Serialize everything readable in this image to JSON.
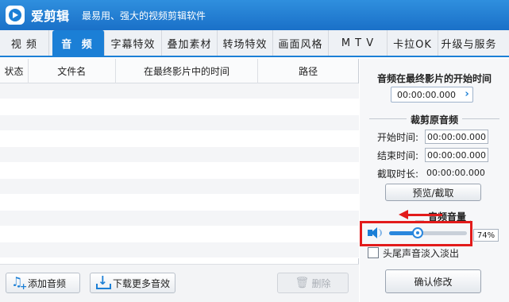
{
  "app": {
    "name": "爱剪辑",
    "slogan": "最易用、强大的视频剪辑软件"
  },
  "tabs": [
    {
      "label": "视 频",
      "active": false
    },
    {
      "label": "音 频",
      "active": true
    },
    {
      "label": "字幕特效",
      "active": false
    },
    {
      "label": "叠加素材",
      "active": false
    },
    {
      "label": "转场特效",
      "active": false
    },
    {
      "label": "画面风格",
      "active": false
    },
    {
      "label": "M T V",
      "active": false
    },
    {
      "label": "卡拉OK",
      "active": false
    },
    {
      "label": "升级与服务",
      "active": false
    }
  ],
  "table": {
    "columns": [
      "状态",
      "文件名",
      "在最终影片中的时间",
      "路径"
    ],
    "rows": []
  },
  "buttons": {
    "add_audio": "添加音频",
    "download_more": "下载更多音效",
    "delete": "删除"
  },
  "panel": {
    "start_time_title": "音频在最终影片的开始时间",
    "start_time_value": "00:00:00.000",
    "start_time_arrow": "›",
    "trim_title": "裁剪原音频",
    "start_label": "开始时间:",
    "start_value": "00:00:00.000",
    "end_label": "结束时间:",
    "end_value": "00:00:00.000",
    "duration_label": "截取时长:",
    "duration_value": "00:00:00.000",
    "preview_button": "预览/截取",
    "volume_title": "音频音量",
    "volume_percent": "74%",
    "volume_level": 0.37,
    "fade_label": "头尾声音淡入淡出",
    "fade_checked": false,
    "confirm_button": "确认修改"
  },
  "colors": {
    "accent": "#1b7fd6",
    "highlight": "#e21b1b"
  }
}
